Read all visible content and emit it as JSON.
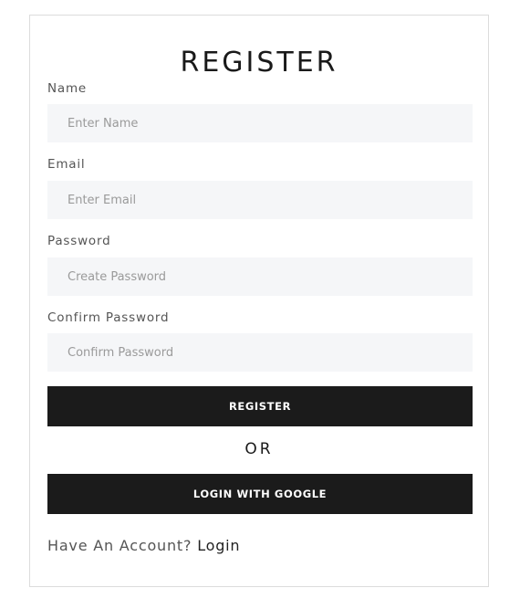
{
  "form": {
    "title": "REGISTER",
    "name": {
      "label": "Name",
      "placeholder": "Enter Name",
      "value": ""
    },
    "email": {
      "label": "Email",
      "placeholder": "Enter Email",
      "value": ""
    },
    "password": {
      "label": "Password",
      "placeholder": "Create Password",
      "value": ""
    },
    "confirm_password": {
      "label": "Confirm Password",
      "placeholder": "Confirm Password",
      "value": ""
    },
    "register_button": "REGISTER",
    "separator": "OR",
    "google_button": "LOGIN WITH GOOGLE",
    "footer": {
      "prompt": "Have An Account?",
      "link": "Login"
    }
  },
  "colors": {
    "button_bg": "#1b1b1b",
    "field_bg": "#f5f6f8",
    "border": "#dcdcdc"
  }
}
